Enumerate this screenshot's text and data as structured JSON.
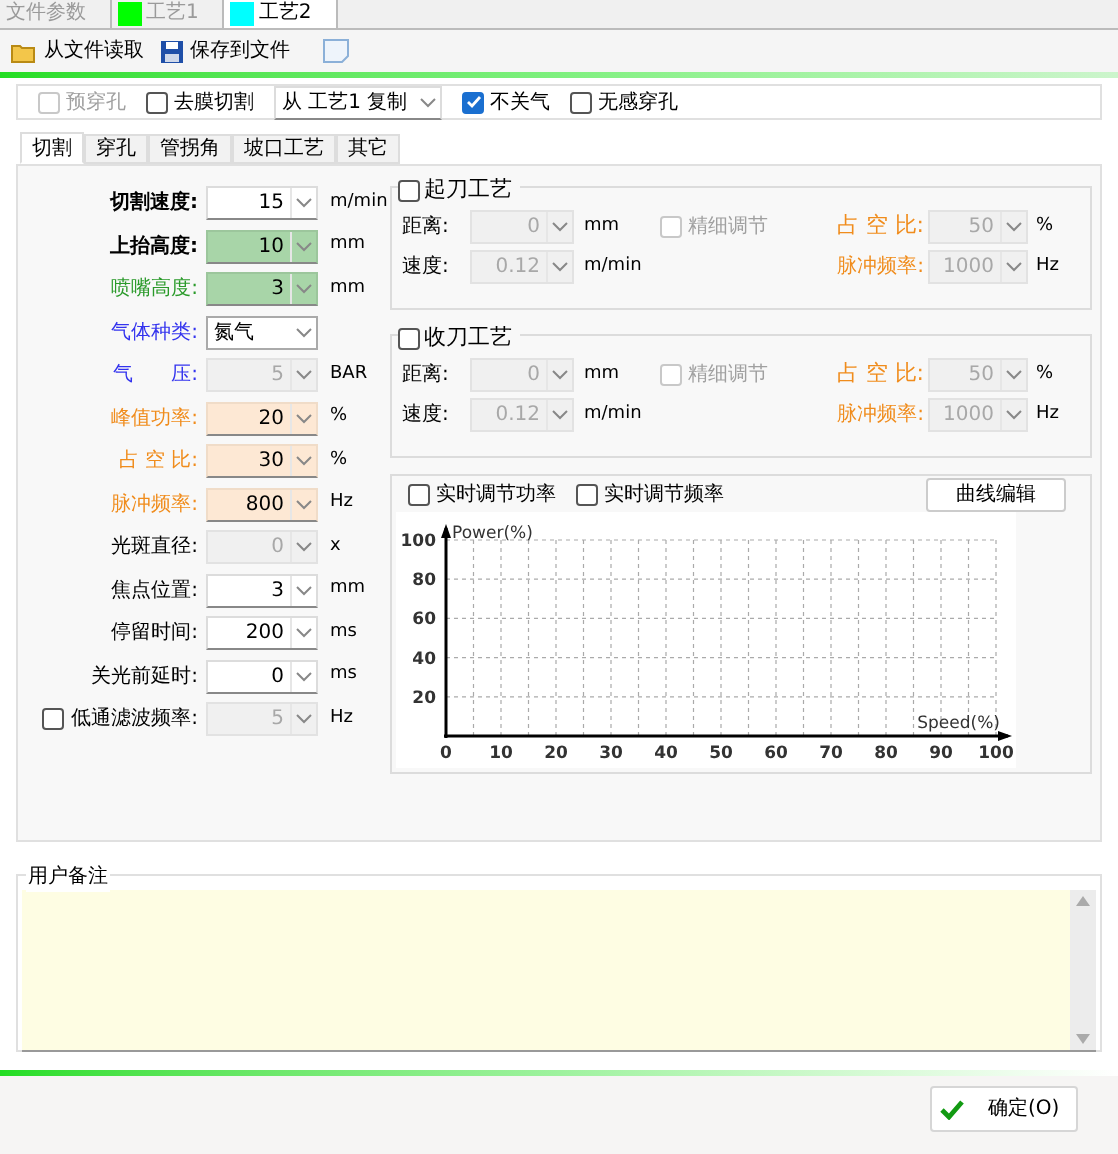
{
  "doc_tabs": [
    {
      "label": "文件参数",
      "selected": false
    },
    {
      "label": "工艺1",
      "color": "#00ff00",
      "selected": false
    },
    {
      "label": "工艺2",
      "color": "#00ffff",
      "selected": true
    }
  ],
  "toolbar": [
    "从文件读取",
    "保存到文件"
  ],
  "options": [
    {
      "kind": "check",
      "label": "预穿孔",
      "checked": false,
      "disabled": true
    },
    {
      "kind": "check",
      "label": "去膜切割",
      "checked": false,
      "disabled": false
    },
    {
      "kind": "select",
      "value": "从 工艺1 复制"
    },
    {
      "kind": "check",
      "label": "不关气",
      "checked": true,
      "disabled": false
    },
    {
      "kind": "check",
      "label": "无感穿孔",
      "checked": false,
      "disabled": false
    }
  ],
  "tabs": [
    {
      "label": "切割",
      "selected": true
    },
    {
      "label": "穿孔",
      "selected": false
    },
    {
      "label": "管拐角",
      "selected": false
    },
    {
      "label": "坡口工艺",
      "selected": false
    },
    {
      "label": "其它",
      "selected": false
    }
  ],
  "params": [
    {
      "label": "切割速度:",
      "kind": "main",
      "value": "15",
      "unit": "m/min",
      "disabled": false,
      "highlighted": false
    },
    {
      "label": "上抬高度:",
      "kind": "main",
      "value": "10",
      "unit": "mm",
      "disabled": false,
      "highlighted": true
    },
    {
      "label": "喷嘴高度:",
      "kind": "nozzle",
      "value": "3",
      "unit": "mm",
      "disabled": false,
      "highlighted": true
    },
    {
      "label": "气体种类:",
      "kind": "select",
      "value": "氮气"
    },
    {
      "label": "气      压:",
      "kind": "gas",
      "value": "5",
      "unit": "BAR",
      "disabled": true,
      "highlighted": false
    },
    {
      "label": "峰值功率:",
      "kind": "pulse",
      "value": "20",
      "unit": "%",
      "disabled": false,
      "highlighted": false
    },
    {
      "label": "占 空 比:",
      "kind": "pulse",
      "value": "30",
      "unit": "%",
      "disabled": false,
      "highlighted": false
    },
    {
      "label": "脉冲频率:",
      "kind": "pulse",
      "value": "800",
      "unit": "Hz",
      "disabled": false,
      "highlighted": false
    },
    {
      "label": "光斑直径:",
      "kind": "plain",
      "value": "0",
      "unit": "x",
      "disabled": true,
      "highlighted": false
    },
    {
      "label": "焦点位置:",
      "kind": "plain",
      "value": "3",
      "unit": "mm",
      "disabled": false,
      "highlighted": false
    },
    {
      "label": "停留时间:",
      "kind": "plain",
      "value": "200",
      "unit": "ms",
      "disabled": false,
      "highlighted": false
    },
    {
      "label": "关光前延时:",
      "kind": "plain",
      "value": "0",
      "unit": "ms",
      "disabled": false,
      "highlighted": false
    },
    {
      "label": "低通滤波频率:",
      "kind": "filter",
      "checked": false,
      "value": "5",
      "unit": "Hz",
      "disabled": true,
      "highlighted": false
    }
  ],
  "groups": [
    {
      "title": "起刀工艺",
      "checked": false,
      "distance": {
        "label": "距离:",
        "value": "0",
        "unit": "mm"
      },
      "speed": {
        "label": "速度:",
        "value": "0.12",
        "unit": "m/min"
      },
      "fine": {
        "label": "精细调节",
        "checked": false
      },
      "duty": {
        "label": "占 空 比:",
        "value": "50",
        "unit": "%"
      },
      "freq": {
        "label": "脉冲频率:",
        "value": "1000",
        "unit": "Hz"
      }
    },
    {
      "title": "收刀工艺",
      "checked": false,
      "distance": {
        "label": "距离:",
        "value": "0",
        "unit": "mm"
      },
      "speed": {
        "label": "速度:",
        "value": "0.12",
        "unit": "m/min"
      },
      "fine": {
        "label": "精细调节",
        "checked": false
      },
      "duty": {
        "label": "占 空 比:",
        "value": "50",
        "unit": "%"
      },
      "freq": {
        "label": "脉冲频率:",
        "value": "1000",
        "unit": "Hz"
      }
    }
  ],
  "curve": {
    "checks": [
      {
        "label": "实时调节功率",
        "checked": false
      },
      {
        "label": "实时调节频率",
        "checked": false
      }
    ],
    "edit_button": "曲线编辑",
    "chart_data": {
      "type": "line",
      "grid": true,
      "xlabel": "Speed(%)",
      "ylabel": "Power(%)",
      "xlim": [
        0,
        100
      ],
      "ylim": [
        0,
        100
      ],
      "xticks": [
        0,
        10,
        20,
        30,
        40,
        50,
        60,
        70,
        80,
        90,
        100
      ],
      "yticks": [
        20,
        40,
        60,
        80,
        100
      ]
    }
  },
  "notes": {
    "title": "用户备注"
  },
  "ok_button": "确定(O)"
}
